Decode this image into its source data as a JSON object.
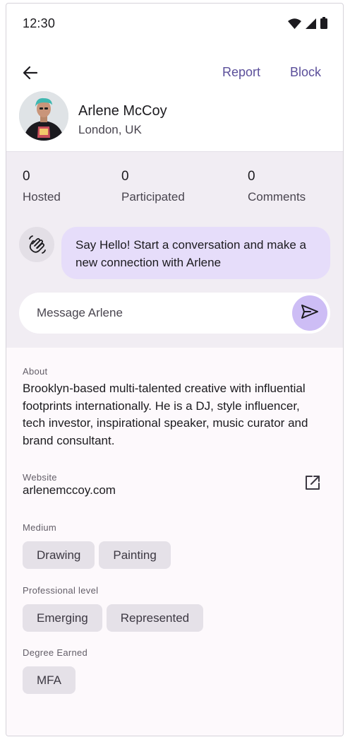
{
  "status_bar": {
    "time": "12:30"
  },
  "top_bar": {
    "report_label": "Report",
    "block_label": "Block"
  },
  "profile": {
    "name": "Arlene McCoy",
    "location": "London, UK"
  },
  "stats": [
    {
      "value": "0",
      "label": "Hosted"
    },
    {
      "value": "0",
      "label": "Participated"
    },
    {
      "value": "0",
      "label": "Comments"
    }
  ],
  "hello": {
    "text": "Say Hello! Start a conversation and make a new connection with Arlene"
  },
  "message": {
    "placeholder": "Message Arlene"
  },
  "about": {
    "label": "About",
    "text": "Brooklyn-based multi-talented creative with influential footprints internationally. He is a DJ, style influencer, tech investor, inspirational speaker, music curator and brand consultant."
  },
  "website": {
    "label": "Website",
    "value": "arlenemccoy.com"
  },
  "medium": {
    "label": "Medium",
    "chips": [
      "Drawing",
      "Painting"
    ]
  },
  "professional_level": {
    "label": "Professional level",
    "chips": [
      "Emerging",
      "Represented"
    ]
  },
  "degree": {
    "label": "Degree Earned",
    "chips": [
      "MFA"
    ]
  },
  "icons": {
    "back": "arrow-left-icon",
    "send": "send-icon",
    "wave": "waving-hand-icon",
    "open_link": "open-in-new-icon",
    "wifi": "wifi-icon",
    "signal": "cellular-signal-icon",
    "battery": "battery-icon"
  },
  "colors": {
    "accent": "#5b4f9a",
    "bubble": "#e6ddfa",
    "send_button": "#cdbdf5",
    "panel": "#f1edf3",
    "chip": "#e5e1e8"
  }
}
